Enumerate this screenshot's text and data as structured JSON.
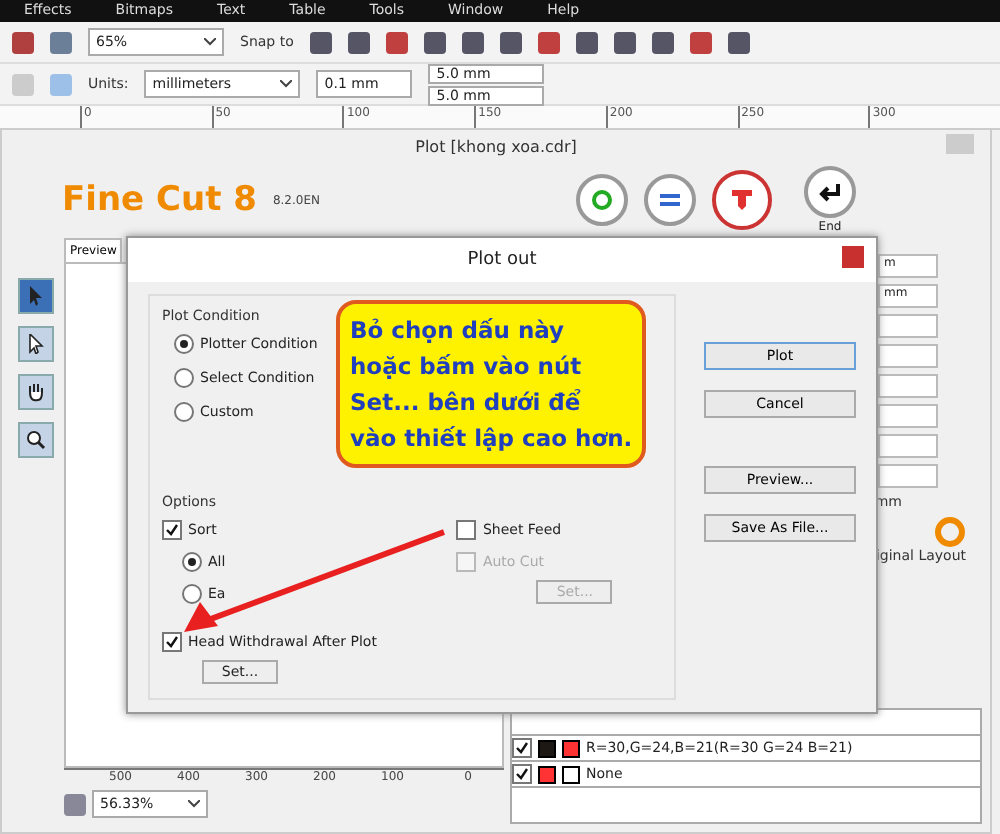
{
  "menu": [
    "Effects",
    "Bitmaps",
    "Text",
    "Table",
    "Tools",
    "Window",
    "Help"
  ],
  "toolbar": {
    "zoom": "65%",
    "snap": "Snap to"
  },
  "property_bar": {
    "units_label": "Units:",
    "units": "millimeters",
    "nudge": "0.1 mm",
    "dup_x": "5.0 mm",
    "dup_y": "5.0 mm"
  },
  "ruler": [
    "0",
    "50",
    "100",
    "150",
    "200",
    "250",
    "300"
  ],
  "plot_window": {
    "title": "Plot [khong xoa.cdr]",
    "logo": "Fine Cut 8",
    "version": "8.2.0EN",
    "end_label": "End",
    "tabs": [
      {
        "label": "Preview",
        "selected": true
      }
    ],
    "tools": [
      {
        "kind": "pointer",
        "selected": true
      },
      {
        "kind": "node",
        "selected": false
      },
      {
        "kind": "hand",
        "selected": false
      },
      {
        "kind": "zoom",
        "selected": false
      }
    ],
    "spin_fields": [
      "m",
      "mm"
    ],
    "unit_label": "mm",
    "layout_label": "iginal Layout",
    "bottom_ruler": [
      "500",
      "400",
      "300",
      "200",
      "100",
      "0"
    ],
    "zoom": "56.33%",
    "layers": [
      {
        "kind": "color",
        "name": "R=30,G=24,B=21(R=30 G=24 B=21)",
        "checked": true
      },
      {
        "kind": "none",
        "name": "None",
        "checked": true
      }
    ]
  },
  "dialog": {
    "title": "Plot out",
    "plot_condition": {
      "title": "Plot Condition",
      "options": [
        {
          "label": "Plotter Condition",
          "selected": true
        },
        {
          "label": "Select Condition",
          "selected": false
        },
        {
          "label": "Custom",
          "selected": false
        }
      ]
    },
    "options": {
      "title": "Options",
      "sort": {
        "label": "Sort",
        "checked": true
      },
      "sort_modes": [
        {
          "label": "All",
          "selected": true
        },
        {
          "label": "Ea",
          "selected": false
        }
      ],
      "head_withdrawal": {
        "label": "Head Withdrawal After Plot",
        "checked": true
      },
      "set_button": {
        "label": "Set...",
        "disabled": false
      },
      "sheet_feed": {
        "label": "Sheet Feed",
        "checked": false,
        "disabled": false
      },
      "auto_cut": {
        "label": "Auto Cut",
        "checked": false,
        "disabled": true
      },
      "set_button_2": {
        "label": "Set...",
        "disabled": true
      }
    },
    "buttons": [
      {
        "label": "Plot",
        "default": true
      },
      {
        "label": "Cancel",
        "default": false
      },
      {
        "label": "Preview...",
        "default": false
      },
      {
        "label": "Save As File...",
        "default": false
      }
    ]
  },
  "callout": {
    "lines": [
      "Bỏ chọn dấu này",
      "hoặc bấm vào nút",
      "Set... bên dưới để",
      "vào thiết lập cao hơn."
    ]
  }
}
